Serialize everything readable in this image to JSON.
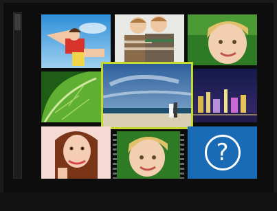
{
  "viewer": {
    "colors": {
      "selection_border": "#c6d92c",
      "help_tile_background": "#1a6bb5",
      "background": "#0d0d0d"
    },
    "thumbnails": [
      {
        "id": "girls-in-sky",
        "icon": "photo-icon"
      },
      {
        "id": "twin-boys",
        "icon": "photo-icon"
      },
      {
        "id": "girl-portrait-green",
        "icon": "photo-icon"
      },
      {
        "id": "green-leaf",
        "icon": "photo-icon"
      },
      {
        "id": "beach-couple",
        "icon": "photo-icon",
        "selected": true
      },
      {
        "id": "night-city",
        "icon": "photo-icon"
      },
      {
        "id": "smiling-woman",
        "icon": "photo-icon"
      },
      {
        "id": "girl-video",
        "icon": "video-icon"
      },
      {
        "id": "unknown-file",
        "icon": "question-mark-icon"
      }
    ],
    "help_glyph": "?"
  }
}
